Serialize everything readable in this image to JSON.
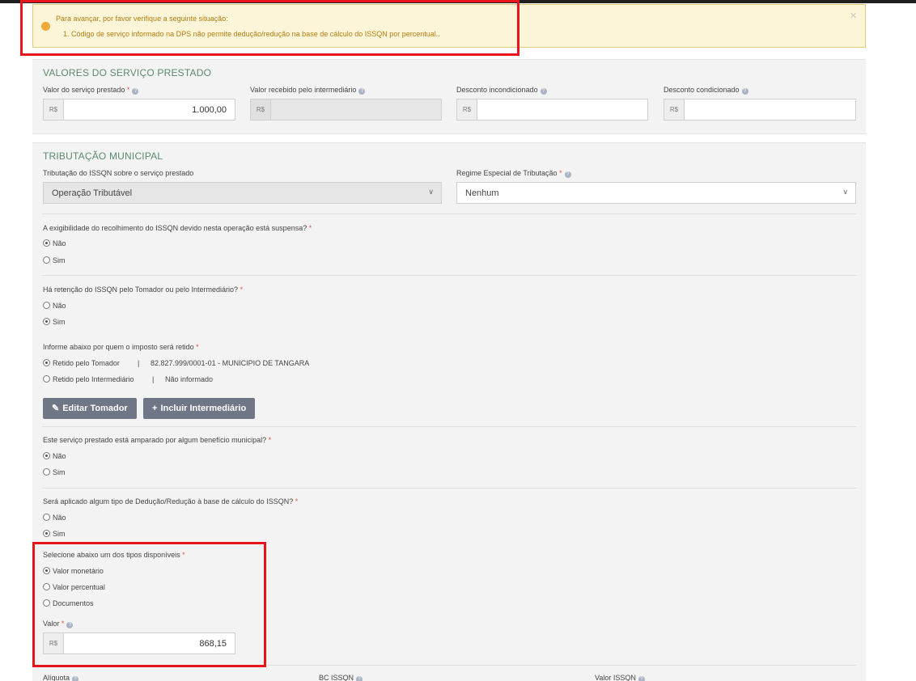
{
  "alert": {
    "title": "Para avançar, por favor verifique a seguinte situação:",
    "message": "1. Código de serviço informado na DPS não permite dedução/redução na base de cálculo do ISSQN por percentual..",
    "close": "×"
  },
  "valores": {
    "title": "VALORES DO SERVIÇO PRESTADO",
    "currency_prefix": "R$",
    "fields": [
      {
        "label": "Valor do serviço prestado",
        "value": "1.000,00"
      },
      {
        "label": "Valor recebido pelo intermediário",
        "value": ""
      },
      {
        "label": "Desconto incondicionado",
        "value": ""
      },
      {
        "label": "Desconto condicionado",
        "value": ""
      }
    ]
  },
  "tributacao": {
    "title": "TRIBUTAÇÃO MUNICIPAL",
    "tributacao_label": "Tributação do ISSQN sobre o serviço prestado",
    "tributacao_value": "Operação Tributável",
    "regime_label": "Regime Especial de Tributação",
    "regime_value": "Nenhum"
  },
  "exigibilidade": {
    "question": "A exigibilidade do recolhimento do ISSQN devido nesta operação está suspensa?",
    "options": [
      "Não",
      "Sim"
    ],
    "selected": "Não"
  },
  "retencao": {
    "question": "Há retenção do ISSQN pelo Tomador ou pelo Intermediário?",
    "options": [
      "Não",
      "Sim"
    ],
    "selected": "Sim",
    "retido_question": "Informe abaixo por quem o imposto será retido",
    "retido_options": [
      {
        "label": "Retido pelo Tomador",
        "detail": "82.827.999/0001-01 - MUNICIPIO DE TANGARA"
      },
      {
        "label": "Retido pelo Intermediário",
        "detail": "Não informado"
      }
    ],
    "retido_selected": "Retido pelo Tomador",
    "separator": "|",
    "edit_button": "Editar Tomador",
    "include_button": "Incluir Intermediário"
  },
  "beneficio": {
    "question": "Este serviço prestado está amparado por algum benefício municipal?",
    "options": [
      "Não",
      "Sim"
    ],
    "selected": "Não"
  },
  "deducao": {
    "question": "Será aplicado algum tipo de Dedução/Redução à base de cálculo do ISSQN?",
    "options": [
      "Não",
      "Sim"
    ],
    "selected": "Sim",
    "tipo_label": "Selecione abaixo um dos tipos disponíveis",
    "tipo_options": [
      "Valor monetário",
      "Valor percentual",
      "Documentos"
    ],
    "tipo_selected": "Valor monetário",
    "valor_label": "Valor",
    "valor_value": "868,15"
  },
  "bottom_labels": {
    "aliquota": "Alíquota",
    "bc_issqn": "BC ISSQN",
    "valor_issqn": "Valor ISSQN"
  },
  "colors": {
    "alert_bg": "#fcf5d7",
    "alert_text": "#b57d12",
    "section_title": "#5b8a6e",
    "button_bg": "#6f7787",
    "highlight_border": "#e8151c"
  },
  "icons": {
    "warning": "warning-circle-icon",
    "help": "question-circle-icon",
    "dropdown": "chevron-down-icon",
    "edit": "pencil-icon",
    "add": "plus-icon"
  }
}
